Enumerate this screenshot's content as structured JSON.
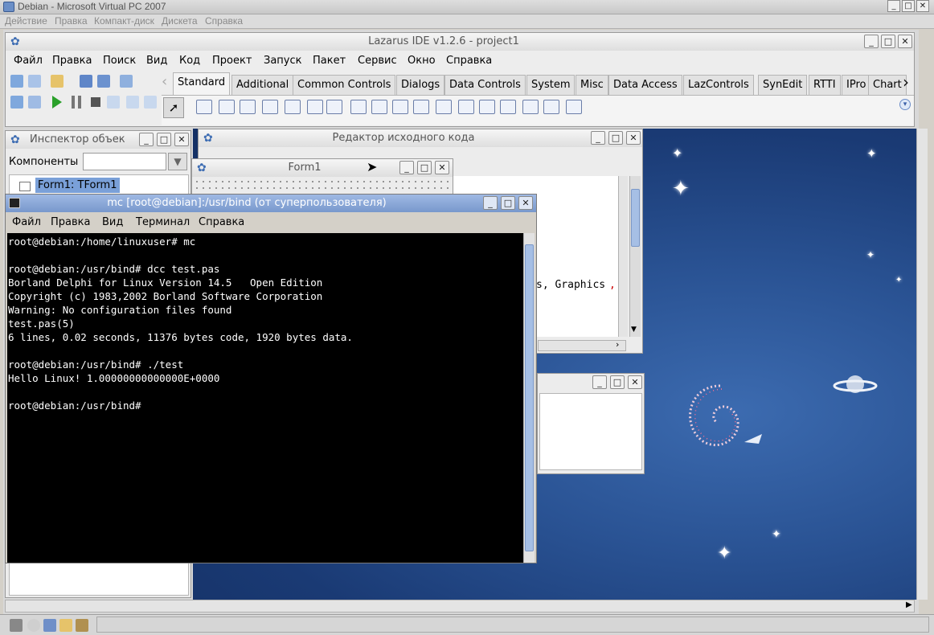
{
  "vpc": {
    "title": "Debian - Microsoft Virtual PC 2007",
    "menu": [
      "Действие",
      "Правка",
      "Компакт-диск",
      "Дискета",
      "Справка"
    ]
  },
  "lazarus": {
    "title": "Lazarus IDE v1.2.6 - project1",
    "menu": [
      "Файл",
      "Правка",
      "Поиск",
      "Вид",
      "Код",
      "Проект",
      "Запуск",
      "Пакет",
      "Сервис",
      "Окно",
      "Справка"
    ],
    "palette_tabs": [
      "Standard",
      "Additional",
      "Common Controls",
      "Dialogs",
      "Data Controls",
      "System",
      "Misc",
      "Data Access",
      "LazControls",
      "SynEdit",
      "RTTI",
      "IPro",
      "Chart"
    ],
    "active_tab": "Standard"
  },
  "inspector": {
    "title": "Инспектор объек",
    "components_label": "Компоненты",
    "tree_item": "Form1: TForm1"
  },
  "source_editor": {
    "title": "Редактор исходного кода",
    "code_fragment_a": "s, Graphics",
    "code_fragment_b": ","
  },
  "form1": {
    "title": "Form1"
  },
  "terminal": {
    "title": "mc [root@debian]:/usr/bind (от суперпользователя)",
    "menu": [
      "Файл",
      "Правка",
      "Вид",
      "Терминал",
      "Справка"
    ],
    "lines": [
      "root@debian:/home/linuxuser# mc",
      "",
      "root@debian:/usr/bind# dcc test.pas",
      "Borland Delphi for Linux Version 14.5   Open Edition",
      "Copyright (c) 1983,2002 Borland Software Corporation",
      "Warning: No configuration files found",
      "test.pas(5)",
      "6 lines, 0.02 seconds, 11376 bytes code, 1920 bytes data.",
      "",
      "root@debian:/usr/bind# ./test",
      "Hello Linux! 1.00000000000000E+0000",
      "",
      "root@debian:/usr/bind#"
    ]
  },
  "icons": {
    "app": "lazarus-paw-icon",
    "terminal": "terminal-icon"
  },
  "colors": {
    "desktop": "#2a5394",
    "terminal_bg": "#000000",
    "terminal_title": "#7898cc",
    "selection": "#7aa0d8"
  }
}
